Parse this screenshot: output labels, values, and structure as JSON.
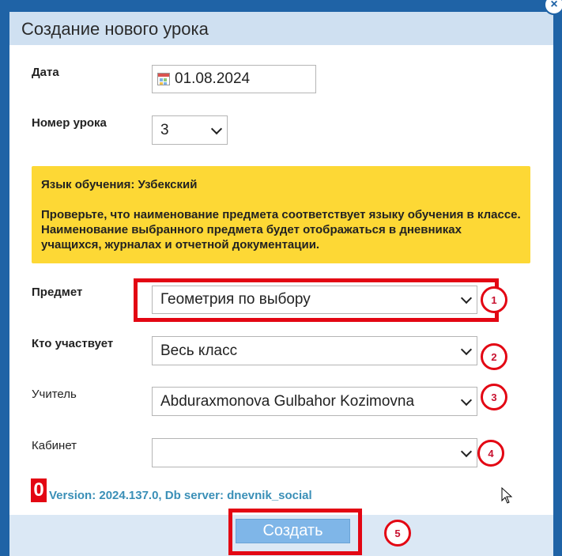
{
  "dialog": {
    "title": "Создание нового урока",
    "close_glyph": "×"
  },
  "form": {
    "date": {
      "label": "Дата",
      "value": "01.08.2024"
    },
    "lesson_number": {
      "label": "Номер урока",
      "value": "3"
    },
    "notice": {
      "line1": "Язык обучения: Узбекский",
      "line2": "Проверьте, что наименование предмета соответствует языку обучения в классе. Наименование выбранного предмета будет отображаться в дневниках учащихся, журналах и отчетной документации."
    },
    "subject": {
      "label": "Предмет",
      "value": "Геометрия по выбору"
    },
    "participants": {
      "label": "Кто участвует",
      "value": "Весь класс"
    },
    "teacher": {
      "label": "Учитель",
      "value": "Abduraxmonova Gulbahor Kozimovna"
    },
    "room": {
      "label": "Кабинет",
      "value": ""
    }
  },
  "version": {
    "badge": "0",
    "text": "Version: 2024.137.0, Db server: dnevnik_social"
  },
  "footer": {
    "submit_label": "Создать"
  },
  "annotations": [
    "1",
    "2",
    "3",
    "4",
    "5"
  ],
  "colors": {
    "accent": "#1f63a6",
    "notice": "#fdd835",
    "highlight": "#e30613",
    "button": "#7fb6e8",
    "version_text": "#3a8fb7"
  }
}
